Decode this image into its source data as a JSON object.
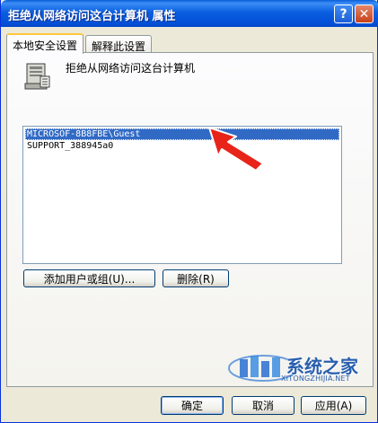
{
  "window": {
    "title": "拒绝从网络访问这台计算机 属性"
  },
  "title_buttons": {
    "help": "?",
    "close": "✕"
  },
  "tabs": [
    {
      "label": "本地安全设置",
      "selected": true
    },
    {
      "label": "解释此设置",
      "selected": false
    }
  ],
  "policy": {
    "name": "拒绝从网络访问这台计算机",
    "icon": "policy-computer-icon"
  },
  "list": {
    "items": [
      {
        "label": "MICROSOF-8B8FBE\\Guest",
        "selected": true
      },
      {
        "label": "SUPPORT_388945a0",
        "selected": false
      }
    ]
  },
  "buttons": {
    "add": "添加用户或组(U)...",
    "remove": "删除(R)",
    "ok": "确定",
    "cancel": "取消",
    "apply": "应用(A)"
  },
  "annotation": {
    "icon": "red-arrow-icon",
    "color": "#e8241a"
  },
  "watermark": {
    "brand": "系统之家",
    "url": "XITONGZHIJIA.NET"
  },
  "colors": {
    "titlebar": "#0a5fe0",
    "selection": "#316ac5",
    "panel": "#fcfcfe",
    "face": "#ece9d8"
  }
}
